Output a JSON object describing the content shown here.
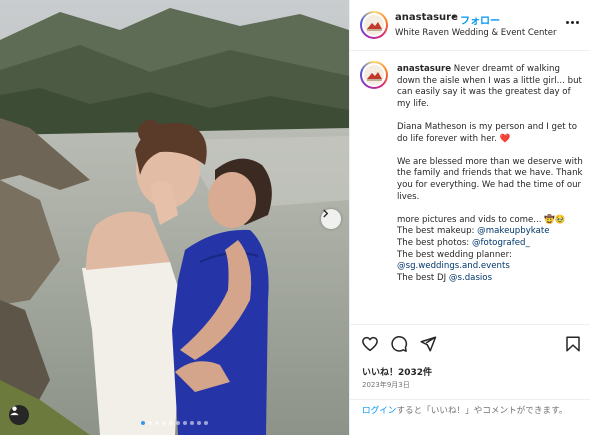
{
  "post": {
    "username": "anastasure",
    "separator": "•",
    "follow_label": "フォロー",
    "location": "White Raven Wedding & Event Center"
  },
  "caption": {
    "username": "anastasure",
    "line1": "Never dreamt of walking down the aisle when I was a little girl... but can easily say it was the greatest day of my life.",
    "line2": "Diana Matheson is my person and I get to do life forever with her. ❤️",
    "line3": "We are blessed more than we deserve with the family and friends that we have. Thank you for everything. We had the time of our lives.",
    "line4": "more pictures and vids to come... 🤠🥹",
    "credits": [
      {
        "label": "The best makeup: ",
        "handle": "@makeupbykate"
      },
      {
        "label": "The best photos: ",
        "handle": "@fotografed_"
      },
      {
        "label": "The best wedding planner: ",
        "handle": "@sg.weddings.and.events"
      },
      {
        "label": "The best DJ ",
        "handle": "@s.dasios"
      }
    ]
  },
  "actions": {
    "likes": "いいね！2032件",
    "date": "2023年9月3日"
  },
  "login": {
    "link": "ログイン",
    "rest": "すると「いいね！」やコメントができます。"
  },
  "carousel": {
    "total_slides": 10,
    "current_index": 1
  },
  "colors": {
    "accent": "#0095f6",
    "link": "#00376b",
    "dress": "#2535a8"
  },
  "icons": {
    "like": "heart-icon",
    "comment": "comment-icon",
    "share": "share-icon",
    "save": "bookmark-icon",
    "more": "more-options-icon",
    "next": "chevron-right-icon",
    "tags": "user-tag-icon"
  }
}
